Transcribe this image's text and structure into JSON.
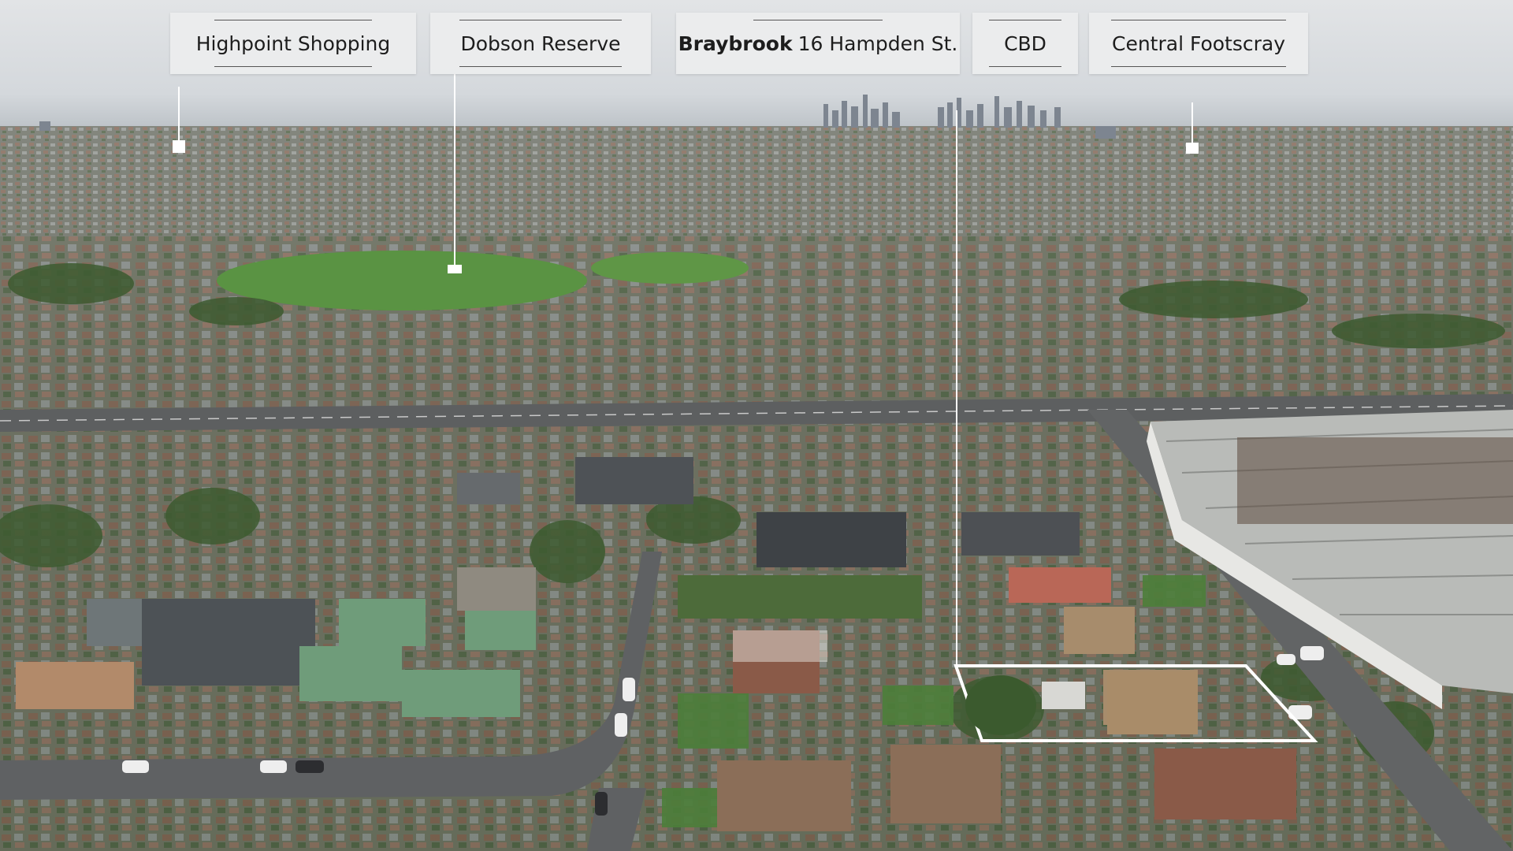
{
  "labels": {
    "highpoint": "Highpoint Shopping",
    "dobson": "Dobson Reserve",
    "braybrook_bold": "Braybrook",
    "braybrook_rest": "16 Hampden St.",
    "cbd": "CBD",
    "footscray": "Central Footscray"
  },
  "colors": {
    "label_bg": "#ecedee",
    "pointer_line": "#ffffff",
    "site_outline": "#ffffff",
    "sky": "#d9dcdf",
    "grass": "#4f8a3a",
    "road": "#5e6062"
  }
}
